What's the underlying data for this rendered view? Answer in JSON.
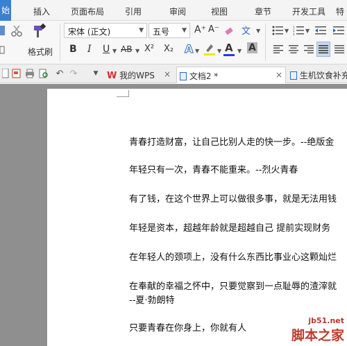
{
  "menu": {
    "active": "始",
    "items": [
      "插入",
      "页面布局",
      "引用",
      "审阅",
      "视图",
      "章节",
      "开发工具",
      "特"
    ]
  },
  "ribbon": {
    "format_painter_label": "格式刷",
    "font_name": "宋体 (正文)",
    "font_size": "五号",
    "bold": "B",
    "italic": "I",
    "underline": "U",
    "strike": "AB",
    "superscript": "X²",
    "subscript": "X₂",
    "phonetic": "文",
    "grow_font": "A⁺",
    "shrink_font": "A⁻",
    "text_effect": "A",
    "font_color": "A",
    "highlight": "A"
  },
  "tabs": [
    {
      "label": "我的WPS",
      "close": "×"
    },
    {
      "label": "文档2 *",
      "close": "×"
    },
    {
      "label": "生机饮食补充"
    }
  ],
  "document": {
    "lines": [
      "青春打造财富，让自己比别人走的快一步。--绝版金",
      "年轻只有一次，青春不能重来。--烈火青春",
      "有了钱，在这个世界上可以做很多事，就是无法用钱",
      "年轻是资本，超越年龄就是超越自己 提前实现财务",
      "在年轻人的颈项上，没有什么东西比事业心这颗灿烂",
      "在奉献的幸福之怀中，只要觉察到一点耻辱的渣滓就",
      "--夏·勃朗特",
      "只要青春在你身上，你就有人"
    ]
  },
  "watermark": {
    "site": "jb51.net",
    "brand": "脚本之家"
  },
  "colors": {
    "accent": "#3a7fd2",
    "wps_red": "#d2322d",
    "page_bg": "#ffffff",
    "workspace_bg": "#8f8f8f"
  }
}
